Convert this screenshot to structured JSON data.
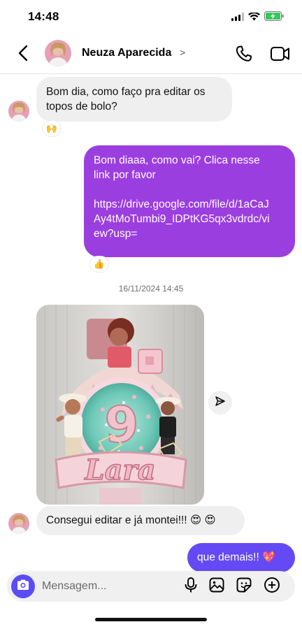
{
  "status": {
    "time": "14:48"
  },
  "header": {
    "contact_name": "Neuza Aparecida",
    "chevron": ">"
  },
  "messages": {
    "m1": {
      "lines": [
        "Bom dia, como faço pra editar os",
        "topos de bolo?"
      ],
      "reaction": "🙌"
    },
    "m2": {
      "lines": [
        "Bom diaaa, como vai? Clica nesse",
        "link por favor",
        "",
        "https://drive.google.com/file/d/1aCaJ",
        "Ay4tMoTumbi9_IDPtKG5qx3vdrdc/vi",
        "ew?usp="
      ],
      "reaction": "👍"
    },
    "timestamp": "16/11/2024 14:45",
    "m4": {
      "text": "Consegui editar e já montei!!! 😍 😍"
    },
    "m5": {
      "text": "que demais!! 💖"
    }
  },
  "photo": {
    "caption_text": "Lara",
    "topper_number": "9"
  },
  "composer": {
    "placeholder": "Mensagem..."
  },
  "colors": {
    "outgoing_purple": "#9b3ee0",
    "outgoing_blue": "#6449f5",
    "incoming_gray": "#efefef",
    "camera_button": "#5b4cf5"
  },
  "icons": [
    "back-chevron",
    "phone",
    "video-camera",
    "send",
    "camera",
    "microphone",
    "image",
    "sticker",
    "plus-circle"
  ]
}
